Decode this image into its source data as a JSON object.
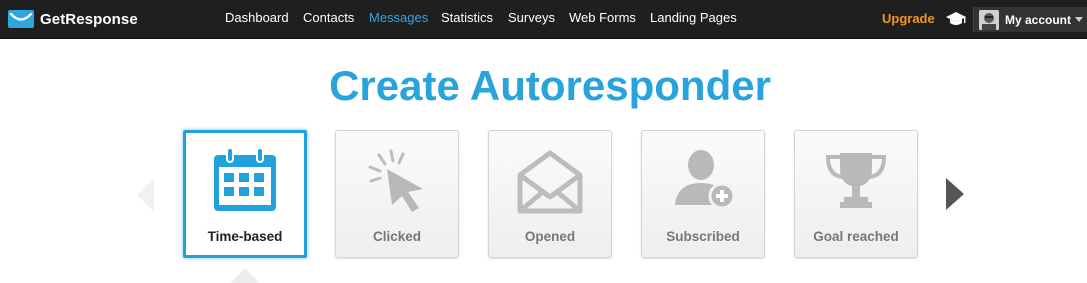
{
  "brand": {
    "name": "GetResponse",
    "logo_icon": "envelope-logo-icon",
    "accent_color": "#29a3dc"
  },
  "nav": {
    "items": [
      {
        "label": "Dashboard",
        "active": false
      },
      {
        "label": "Contacts",
        "active": false
      },
      {
        "label": "Messages",
        "active": true
      },
      {
        "label": "Statistics",
        "active": false
      },
      {
        "label": "Surveys",
        "active": false
      },
      {
        "label": "Web Forms",
        "active": false
      },
      {
        "label": "Landing Pages",
        "active": false
      }
    ],
    "upgrade_label": "Upgrade",
    "upgrade_color": "#f7941d",
    "education_icon": "graduation-cap-icon",
    "account_label": "My account",
    "account_icon": "avatar"
  },
  "page": {
    "title": "Create Autoresponder"
  },
  "autoresponder_types": {
    "selected": "Time-based",
    "items": [
      {
        "label": "Time-based",
        "icon": "calendar-icon",
        "selected": true
      },
      {
        "label": "Clicked",
        "icon": "cursor-click-icon",
        "selected": false
      },
      {
        "label": "Opened",
        "icon": "open-envelope-icon",
        "selected": false
      },
      {
        "label": "Subscribed",
        "icon": "user-add-icon",
        "selected": false
      },
      {
        "label": "Goal reached",
        "icon": "trophy-icon",
        "selected": false
      }
    ],
    "prev_icon": "carousel-prev-arrow-icon",
    "next_icon": "carousel-next-arrow-icon"
  }
}
